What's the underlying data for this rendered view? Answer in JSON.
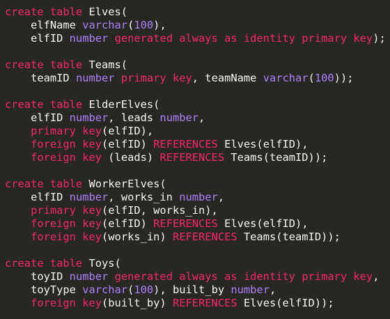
{
  "editor": {
    "lines": [
      [
        {
          "t": "k",
          "v": "create table"
        },
        {
          "t": "p",
          "v": " Elves("
        }
      ],
      [
        {
          "t": "p",
          "v": "    elfName "
        },
        {
          "t": "t",
          "v": "varchar"
        },
        {
          "t": "p",
          "v": "("
        },
        {
          "t": "n",
          "v": "100"
        },
        {
          "t": "p",
          "v": "),"
        }
      ],
      [
        {
          "t": "p",
          "v": "    elfID "
        },
        {
          "t": "t",
          "v": "number"
        },
        {
          "t": "p",
          "v": " "
        },
        {
          "t": "k",
          "v": "generated always as identity primary key"
        },
        {
          "t": "p",
          "v": ");"
        }
      ],
      [],
      [
        {
          "t": "k",
          "v": "create table"
        },
        {
          "t": "p",
          "v": " Teams("
        }
      ],
      [
        {
          "t": "p",
          "v": "    teamID "
        },
        {
          "t": "t",
          "v": "number"
        },
        {
          "t": "p",
          "v": " "
        },
        {
          "t": "k",
          "v": "primary key"
        },
        {
          "t": "p",
          "v": ", teamName "
        },
        {
          "t": "t",
          "v": "varchar"
        },
        {
          "t": "p",
          "v": "("
        },
        {
          "t": "n",
          "v": "100"
        },
        {
          "t": "p",
          "v": "));"
        }
      ],
      [],
      [
        {
          "t": "k",
          "v": "create table"
        },
        {
          "t": "p",
          "v": " ElderElves("
        }
      ],
      [
        {
          "t": "p",
          "v": "    elfID "
        },
        {
          "t": "t",
          "v": "number"
        },
        {
          "t": "p",
          "v": ", leads "
        },
        {
          "t": "t",
          "v": "number"
        },
        {
          "t": "p",
          "v": ","
        }
      ],
      [
        {
          "t": "p",
          "v": "    "
        },
        {
          "t": "k",
          "v": "primary key"
        },
        {
          "t": "p",
          "v": "(elfID),"
        }
      ],
      [
        {
          "t": "p",
          "v": "    "
        },
        {
          "t": "k",
          "v": "foreign key"
        },
        {
          "t": "p",
          "v": "(elfID) "
        },
        {
          "t": "k",
          "v": "REFERENCES"
        },
        {
          "t": "p",
          "v": " Elves(elfID),"
        }
      ],
      [
        {
          "t": "p",
          "v": "    "
        },
        {
          "t": "k",
          "v": "foreign key"
        },
        {
          "t": "p",
          "v": " (leads) "
        },
        {
          "t": "k",
          "v": "REFERENCES"
        },
        {
          "t": "p",
          "v": " Teams(teamID));"
        }
      ],
      [],
      [
        {
          "t": "k",
          "v": "create table"
        },
        {
          "t": "p",
          "v": " WorkerElves("
        }
      ],
      [
        {
          "t": "p",
          "v": "    elfID "
        },
        {
          "t": "t",
          "v": "number"
        },
        {
          "t": "p",
          "v": ", works_in "
        },
        {
          "t": "t",
          "v": "number"
        },
        {
          "t": "p",
          "v": ","
        }
      ],
      [
        {
          "t": "p",
          "v": "    "
        },
        {
          "t": "k",
          "v": "primary key"
        },
        {
          "t": "p",
          "v": "(elfID, works_in),"
        }
      ],
      [
        {
          "t": "p",
          "v": "    "
        },
        {
          "t": "k",
          "v": "foreign key"
        },
        {
          "t": "p",
          "v": "(elfID) "
        },
        {
          "t": "k",
          "v": "REFERENCES"
        },
        {
          "t": "p",
          "v": " Elves(elfID),"
        }
      ],
      [
        {
          "t": "p",
          "v": "    "
        },
        {
          "t": "k",
          "v": "foreign key"
        },
        {
          "t": "p",
          "v": "(works_in) "
        },
        {
          "t": "k",
          "v": "REFERENCES"
        },
        {
          "t": "p",
          "v": " Teams(teamID));"
        }
      ],
      [],
      [
        {
          "t": "k",
          "v": "create table"
        },
        {
          "t": "p",
          "v": " Toys("
        }
      ],
      [
        {
          "t": "p",
          "v": "    toyID "
        },
        {
          "t": "t",
          "v": "number"
        },
        {
          "t": "p",
          "v": " "
        },
        {
          "t": "k",
          "v": "generated always as identity primary key"
        },
        {
          "t": "p",
          "v": ","
        }
      ],
      [
        {
          "t": "p",
          "v": "    toyType "
        },
        {
          "t": "t",
          "v": "varchar"
        },
        {
          "t": "p",
          "v": "("
        },
        {
          "t": "n",
          "v": "100"
        },
        {
          "t": "p",
          "v": "), built_by "
        },
        {
          "t": "t",
          "v": "number"
        },
        {
          "t": "p",
          "v": ","
        }
      ],
      [
        {
          "t": "p",
          "v": "    "
        },
        {
          "t": "k",
          "v": "foreign key"
        },
        {
          "t": "p",
          "v": "(built_by) "
        },
        {
          "t": "k",
          "v": "REFERENCES"
        },
        {
          "t": "p",
          "v": " Elves(elfID));"
        }
      ]
    ]
  }
}
